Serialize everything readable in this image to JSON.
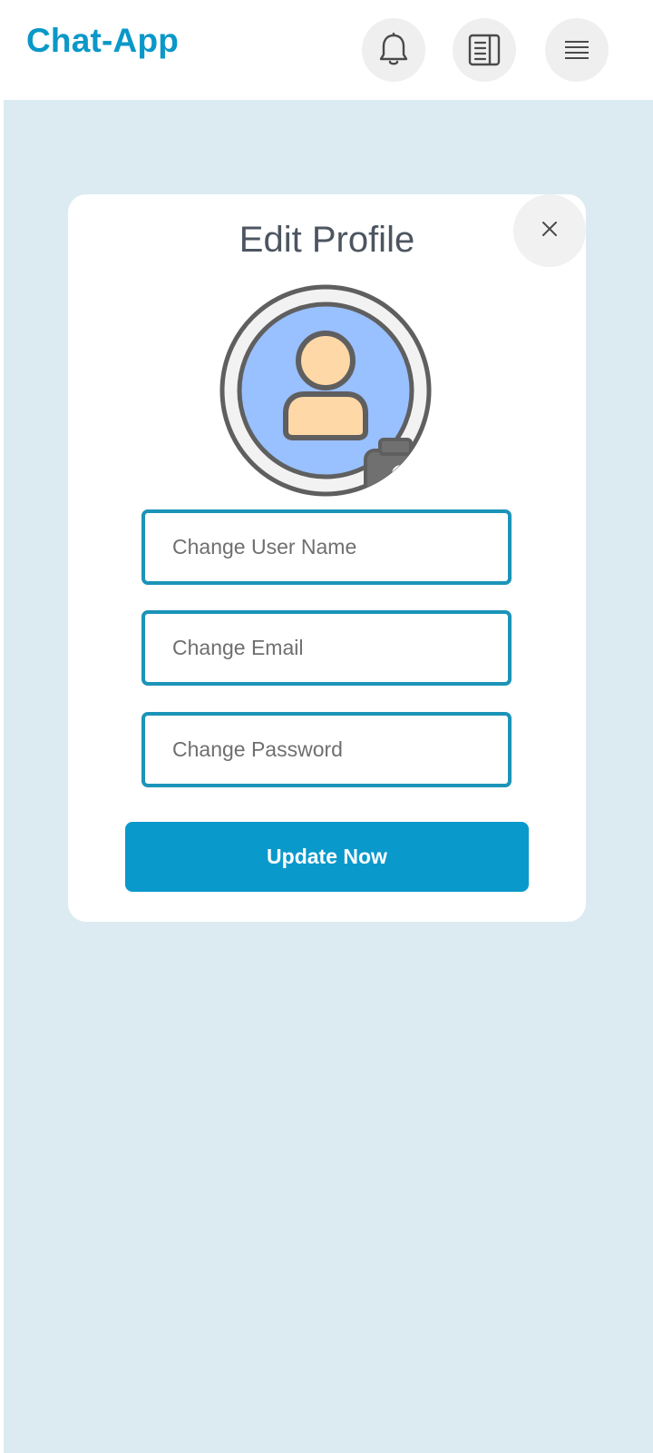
{
  "header": {
    "app_title": "Chat-App",
    "icons": [
      "bell-icon",
      "book-icon",
      "menu-icon"
    ]
  },
  "modal": {
    "title": "Edit Profile",
    "avatar_icon": "user-avatar-icon",
    "camera_icon": "camera-icon",
    "close_icon": "close-icon",
    "fields": {
      "username_placeholder": "Change User Name",
      "email_placeholder": "Change Email",
      "password_placeholder": "Change Password"
    },
    "submit_label": "Update Now"
  },
  "colors": {
    "brand": "#0a98c8",
    "accent_border": "#1b94b8",
    "button": "#0a99cb",
    "page_background": "#dcebf2",
    "avatar_fill": "#99c0ff",
    "avatar_skin": "#ffd8a8"
  }
}
